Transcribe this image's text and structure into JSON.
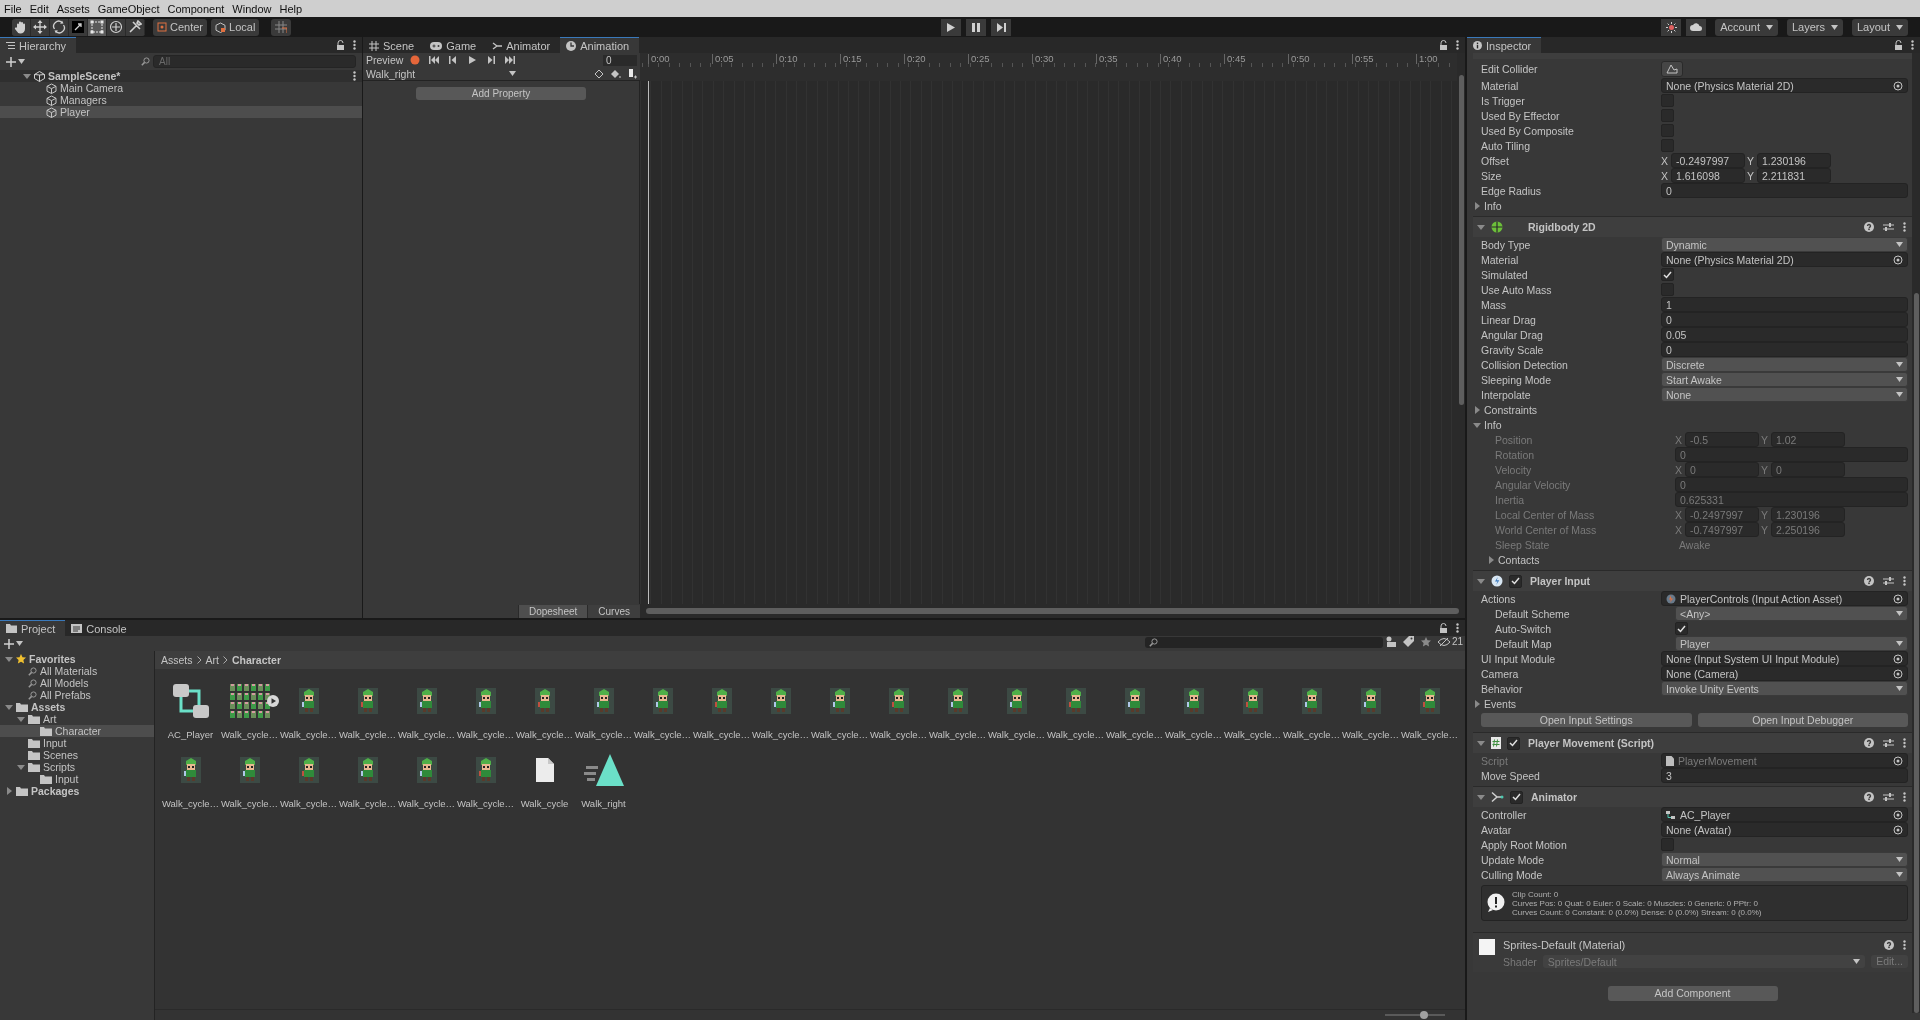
{
  "menu": [
    "File",
    "Edit",
    "Assets",
    "GameObject",
    "Component",
    "Window",
    "Help"
  ],
  "toolbar": {
    "tools": [
      {
        "kind": "hand",
        "selected": false
      },
      {
        "kind": "move",
        "selected": false
      },
      {
        "kind": "rotate",
        "selected": false
      },
      {
        "kind": "scale",
        "selected": false
      },
      {
        "kind": "rect",
        "selected": true
      },
      {
        "kind": "transform",
        "selected": false
      },
      {
        "kind": "custom",
        "selected": false
      }
    ],
    "pivot": "Center",
    "space": "Local",
    "menus": [
      "Account",
      "Layers",
      "Layout"
    ]
  },
  "hierarchy": {
    "title": "Hierarchy",
    "search_placeholder": "All",
    "tree": [
      {
        "label": "SampleScene*",
        "kind": "scene",
        "expanded": true,
        "selected": false,
        "children": [
          {
            "label": "Main Camera",
            "kind": "object",
            "selected": false
          },
          {
            "label": "Managers",
            "kind": "object",
            "selected": false
          },
          {
            "label": "Player",
            "kind": "object",
            "selected": true
          }
        ]
      }
    ]
  },
  "animation": {
    "tabs": [
      {
        "label": "Scene",
        "kind": "scene",
        "selected": false
      },
      {
        "label": "Game",
        "kind": "game",
        "selected": false
      },
      {
        "label": "Animator",
        "kind": "animator",
        "selected": false
      },
      {
        "label": "Animation",
        "kind": "animation",
        "selected": true
      }
    ],
    "preview": "Preview",
    "frame": "0",
    "clip": "Walk_right",
    "add_property": "Add Property",
    "ticks": [
      "0:00",
      "0:05",
      "0:10",
      "0:15",
      "0:20",
      "0:25",
      "0:30",
      "0:35",
      "0:40",
      "0:45",
      "0:50",
      "0:55",
      "1:00"
    ],
    "bottom_tabs": [
      {
        "label": "Dopesheet",
        "selected": true
      },
      {
        "label": "Curves",
        "selected": false
      }
    ]
  },
  "project": {
    "tabs": [
      {
        "label": "Project",
        "kind": "project",
        "selected": true
      },
      {
        "label": "Console",
        "kind": "console",
        "selected": false
      }
    ],
    "tree": [
      {
        "label": "Favorites",
        "kind": "favorites",
        "expanded": true,
        "selected": false,
        "children": [
          {
            "label": "All Materials",
            "kind": "search",
            "selected": false
          },
          {
            "label": "All Models",
            "kind": "search",
            "selected": false
          },
          {
            "label": "All Prefabs",
            "kind": "search",
            "selected": false
          }
        ]
      },
      {
        "label": "Assets",
        "kind": "folder",
        "expanded": true,
        "selected": false,
        "children": [
          {
            "label": "Art",
            "kind": "folder",
            "expanded": true,
            "selected": false,
            "children": [
              {
                "label": "Character",
                "kind": "folder",
                "selected": true
              }
            ]
          },
          {
            "label": "Input",
            "kind": "folder",
            "selected": false
          },
          {
            "label": "Scenes",
            "kind": "folder",
            "selected": false
          },
          {
            "label": "Scripts",
            "kind": "folder",
            "expanded": true,
            "selected": false,
            "children": [
              {
                "label": "Input",
                "kind": "folder",
                "selected": false
              }
            ]
          }
        ]
      },
      {
        "label": "Packages",
        "kind": "folder",
        "expanded": false,
        "selected": false
      }
    ],
    "breadcrumb": [
      "Assets",
      "Art",
      "Character"
    ],
    "hidden_count": "21",
    "items": [
      {
        "label": "AC_Player",
        "kind": "controller"
      },
      {
        "label": "Walk_cycle…",
        "kind": "sheet"
      },
      {
        "label": "Walk_cycle…",
        "kind": "sprite"
      },
      {
        "label": "Walk_cycle…",
        "kind": "sprite"
      },
      {
        "label": "Walk_cycle…",
        "kind": "sprite"
      },
      {
        "label": "Walk_cycle…",
        "kind": "sprite"
      },
      {
        "label": "Walk_cycle…",
        "kind": "sprite"
      },
      {
        "label": "Walk_cycle…",
        "kind": "sprite"
      },
      {
        "label": "Walk_cycle…",
        "kind": "sprite"
      },
      {
        "label": "Walk_cycle…",
        "kind": "sprite"
      },
      {
        "label": "Walk_cycle…",
        "kind": "sprite"
      },
      {
        "label": "Walk_cycle…",
        "kind": "sprite"
      },
      {
        "label": "Walk_cycle…",
        "kind": "sprite"
      },
      {
        "label": "Walk_cycle…",
        "kind": "sprite"
      },
      {
        "label": "Walk_cycle…",
        "kind": "sprite"
      },
      {
        "label": "Walk_cycle…",
        "kind": "sprite"
      },
      {
        "label": "Walk_cycle…",
        "kind": "sprite"
      },
      {
        "label": "Walk_cycle…",
        "kind": "sprite"
      },
      {
        "label": "Walk_cycle…",
        "kind": "sprite"
      },
      {
        "label": "Walk_cycle…",
        "kind": "sprite"
      },
      {
        "label": "Walk_cycle…",
        "kind": "sprite"
      },
      {
        "label": "Walk_cycle…",
        "kind": "sprite"
      },
      {
        "label": "Walk_cycle…",
        "kind": "sprite"
      },
      {
        "label": "Walk_cycle…",
        "kind": "sprite"
      },
      {
        "label": "Walk_cycle…",
        "kind": "sprite"
      },
      {
        "label": "Walk_cycle…",
        "kind": "sprite"
      },
      {
        "label": "Walk_cycle…",
        "kind": "sprite"
      },
      {
        "label": "Walk_cycle…",
        "kind": "sprite"
      },
      {
        "label": "Walk_cycle",
        "kind": "file"
      },
      {
        "label": "Walk_right",
        "kind": "anim"
      }
    ],
    "zoom_slider": {
      "level": 0.65
    }
  },
  "inspector": {
    "title": "Inspector",
    "components": [
      {
        "kind": "partial",
        "rows": [
          {
            "kind": "edit_button",
            "label": "Edit Collider"
          },
          {
            "kind": "object",
            "label": "Material",
            "value": "None (Physics Material 2D)"
          },
          {
            "kind": "checkbox",
            "label": "Is Trigger",
            "checked": false
          },
          {
            "kind": "checkbox",
            "label": "Used By Effector",
            "checked": false
          },
          {
            "kind": "checkbox",
            "label": "Used By Composite",
            "checked": false
          },
          {
            "kind": "checkbox",
            "label": "Auto Tiling",
            "checked": false
          },
          {
            "kind": "vector2",
            "label": "Offset",
            "fields": [
              {
                "axis": "X",
                "value": "-0.2497997"
              },
              {
                "axis": "Y",
                "value": "1.230196"
              }
            ]
          },
          {
            "kind": "vector2",
            "label": "Size",
            "fields": [
              {
                "axis": "X",
                "value": "1.616098"
              },
              {
                "axis": "Y",
                "value": "2.211831"
              }
            ]
          },
          {
            "kind": "number",
            "label": "Edge Radius",
            "value": "0"
          },
          {
            "kind": "foldout",
            "label": "Info",
            "expanded": false
          }
        ]
      },
      {
        "kind": "rigidbody",
        "title": "Rigidbody 2D",
        "expanded": true,
        "rows": [
          {
            "kind": "dropdown",
            "label": "Body Type",
            "value": "Dynamic"
          },
          {
            "kind": "object",
            "label": "Material",
            "value": "None (Physics Material 2D)"
          },
          {
            "kind": "checkbox",
            "label": "Simulated",
            "checked": true
          },
          {
            "kind": "checkbox",
            "label": "Use Auto Mass",
            "checked": false
          },
          {
            "kind": "number",
            "label": "Mass",
            "value": "1"
          },
          {
            "kind": "number",
            "label": "Linear Drag",
            "value": "0"
          },
          {
            "kind": "number",
            "label": "Angular Drag",
            "value": "0.05"
          },
          {
            "kind": "number",
            "label": "Gravity Scale",
            "value": "0"
          },
          {
            "kind": "dropdown",
            "label": "Collision Detection",
            "value": "Discrete"
          },
          {
            "kind": "dropdown",
            "label": "Sleeping Mode",
            "value": "Start Awake"
          },
          {
            "kind": "dropdown",
            "label": "Interpolate",
            "value": "None"
          },
          {
            "kind": "foldout",
            "label": "Constraints",
            "expanded": false
          },
          {
            "kind": "foldout",
            "label": "Info",
            "expanded": true,
            "children": [
              {
                "kind": "vector2",
                "label": "Position",
                "disabled": true,
                "fields": [
                  {
                    "axis": "X",
                    "value": "-0.5"
                  },
                  {
                    "axis": "Y",
                    "value": "1.02"
                  }
                ]
              },
              {
                "kind": "number",
                "label": "Rotation",
                "disabled": true,
                "value": "0"
              },
              {
                "kind": "vector2",
                "label": "Velocity",
                "disabled": true,
                "fields": [
                  {
                    "axis": "X",
                    "value": "0"
                  },
                  {
                    "axis": "Y",
                    "value": "0"
                  }
                ]
              },
              {
                "kind": "number",
                "label": "Angular Velocity",
                "disabled": true,
                "value": "0"
              },
              {
                "kind": "number",
                "label": "Inertia",
                "disabled": true,
                "value": "0.625331"
              },
              {
                "kind": "vector2",
                "label": "Local Center of Mass",
                "disabled": true,
                "fields": [
                  {
                    "axis": "X",
                    "value": "-0.2497997"
                  },
                  {
                    "axis": "Y",
                    "value": "1.230196"
                  }
                ]
              },
              {
                "kind": "vector2",
                "label": "World Center of Mass",
                "disabled": true,
                "fields": [
                  {
                    "axis": "X",
                    "value": "-0.7497997"
                  },
                  {
                    "axis": "Y",
                    "value": "2.250196"
                  }
                ]
              },
              {
                "kind": "text",
                "label": "Sleep State",
                "disabled": true,
                "value": "Awake"
              },
              {
                "kind": "foldout",
                "label": "Contacts",
                "disabled": false,
                "expanded": false
              }
            ]
          }
        ]
      },
      {
        "kind": "player_input",
        "title": "Player Input",
        "enabled": true,
        "expanded": true,
        "rows": [
          {
            "kind": "input_asset",
            "label": "Actions",
            "value": "PlayerControls (Input Action Asset)",
            "children": [
              {
                "kind": "dropdown",
                "label": "Default Scheme",
                "value": "<Any>"
              },
              {
                "kind": "checkbox",
                "label": "Auto-Switch",
                "checked": true
              },
              {
                "kind": "dropdown",
                "label": "Default Map",
                "value": "Player"
              }
            ]
          },
          {
            "kind": "object",
            "label": "UI Input Module",
            "value": "None (Input System UI Input Module)"
          },
          {
            "kind": "object",
            "label": "Camera",
            "value": "None (Camera)"
          },
          {
            "kind": "dropdown",
            "label": "Behavior",
            "value": "Invoke Unity Events"
          },
          {
            "kind": "foldout",
            "label": "Events",
            "expanded": false
          },
          {
            "kind": "buttons",
            "buttons": [
              "Open Input Settings",
              "Open Input Debugger"
            ]
          }
        ]
      },
      {
        "kind": "script",
        "title": "Player Movement (Script)",
        "enabled": true,
        "expanded": true,
        "rows": [
          {
            "kind": "script_asset",
            "label": "Script",
            "disabled": true,
            "value": "PlayerMovement"
          },
          {
            "kind": "number",
            "label": "Move Speed",
            "disabled": false,
            "value": "3"
          }
        ]
      },
      {
        "kind": "animator",
        "title": "Animator",
        "enabled": true,
        "expanded": true,
        "rows": [
          {
            "kind": "controller_asset",
            "label": "Controller",
            "value": "AC_Player"
          },
          {
            "kind": "object",
            "label": "Avatar",
            "value": "None (Avatar)"
          },
          {
            "kind": "checkbox",
            "label": "Apply Root Motion",
            "checked": false
          },
          {
            "kind": "dropdown",
            "label": "Update Mode",
            "value": "Normal"
          },
          {
            "kind": "dropdown",
            "label": "Culling Mode",
            "value": "Always Animate"
          },
          {
            "kind": "info",
            "lines": [
              "Clip Count: 0",
              "Curves Pos: 0 Quat: 0 Euler: 0 Scale: 0 Muscles: 0 Generic: 0 PPtr: 0",
              "Curves Count: 0 Constant: 0 (0.0%) Dense: 0 (0.0%) Stream: 0 (0.0%)"
            ]
          }
        ]
      }
    ],
    "material": {
      "title": "Sprites-Default (Material)",
      "shader_label": "Shader",
      "shader": "Sprites/Default",
      "edit": "Edit..."
    },
    "add_component": "Add Component"
  }
}
